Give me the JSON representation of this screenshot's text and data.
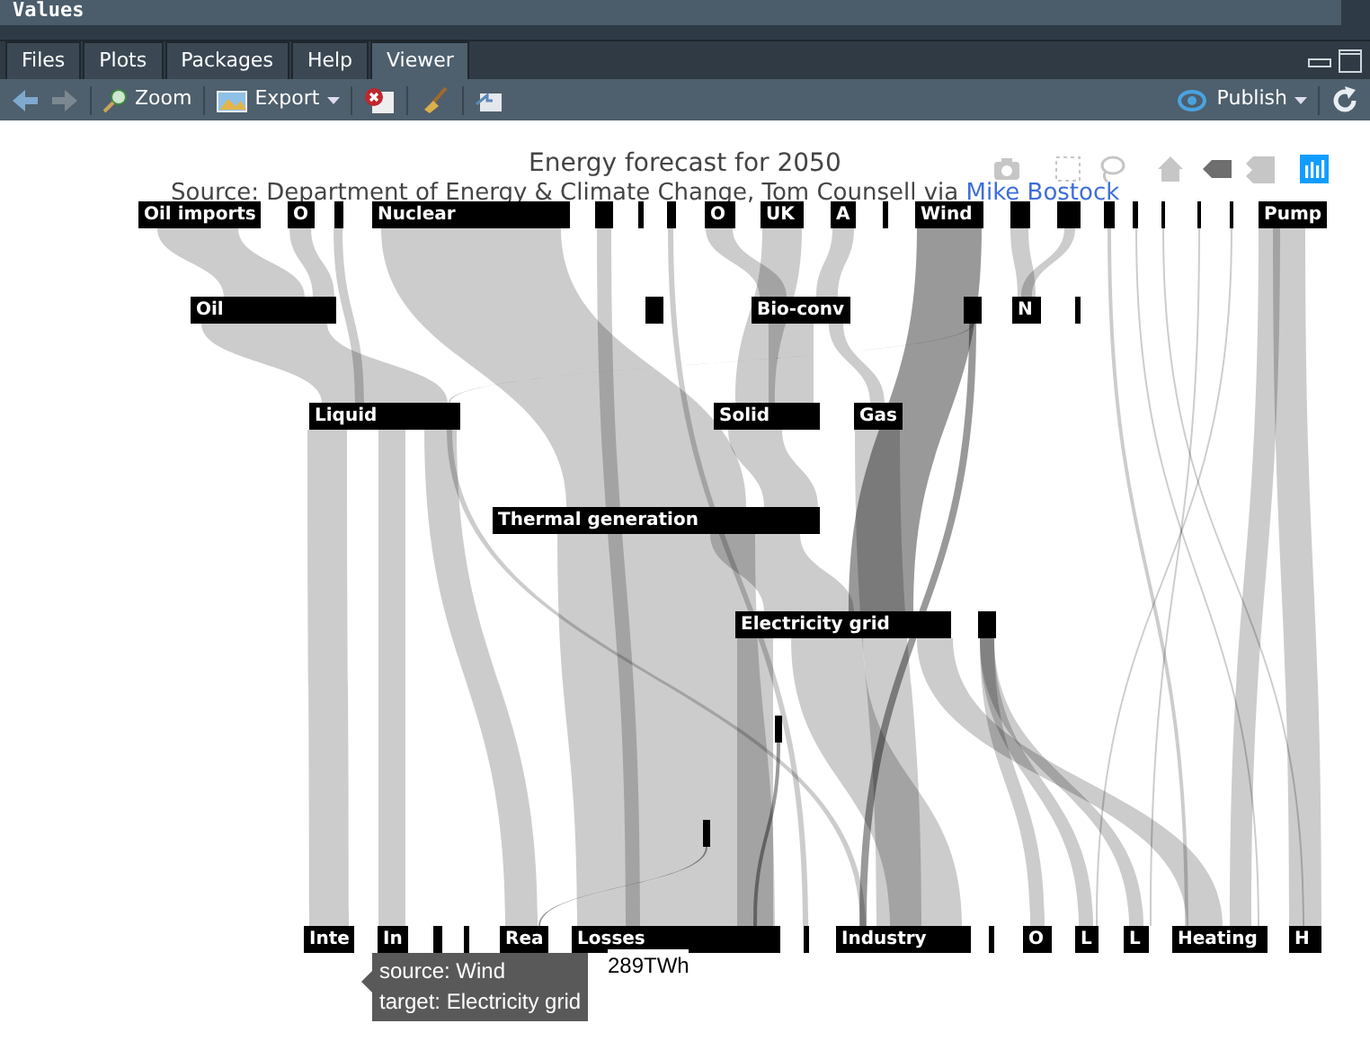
{
  "top_panel": {
    "title": "Values"
  },
  "tabs": [
    {
      "label": "Files",
      "selected": false
    },
    {
      "label": "Plots",
      "selected": false
    },
    {
      "label": "Packages",
      "selected": false
    },
    {
      "label": "Help",
      "selected": false
    },
    {
      "label": "Viewer",
      "selected": true
    }
  ],
  "toolbar": {
    "zoom": "Zoom",
    "export": "Export",
    "publish": "Publish"
  },
  "plot": {
    "title": "Energy forecast for 2050",
    "subtitle": "Source: Department of Energy & Climate Change, Tom Counsell via ",
    "subtitle_link": "Mike Bostock",
    "modebar": [
      {
        "kind": "camera",
        "selected": false
      },
      {
        "kind": "box",
        "selected": false
      },
      {
        "kind": "lasso",
        "selected": false
      },
      {
        "kind": "home",
        "selected": false
      },
      {
        "kind": "closest",
        "selected": true
      },
      {
        "kind": "compare",
        "selected": false
      },
      {
        "kind": "logo",
        "selected": false
      }
    ],
    "nodes": [
      {
        "label": "Oil imports"
      },
      {
        "label": "O"
      },
      {
        "label": "Nuclear"
      },
      {
        "label": "O"
      },
      {
        "label": "UK"
      },
      {
        "label": "A"
      },
      {
        "label": "Wind"
      },
      {
        "label": "Pump"
      },
      {
        "label": "Oil"
      },
      {
        "label": "Bio-conv"
      },
      {
        "label": "N"
      },
      {
        "label": "Liquid"
      },
      {
        "label": "Solid"
      },
      {
        "label": "Gas"
      },
      {
        "label": "Thermal generation"
      },
      {
        "label": "Electricity grid"
      },
      {
        "label": "Inte"
      },
      {
        "label": "In"
      },
      {
        "label": "Rea"
      },
      {
        "label": "Losses"
      },
      {
        "label": "Industry"
      },
      {
        "label": "O"
      },
      {
        "label": "L"
      },
      {
        "label": "L"
      },
      {
        "label": "Heating"
      },
      {
        "label": "H"
      }
    ],
    "tooltip": {
      "source": "source: Wind",
      "target": "target: Electricity grid",
      "value": "289TWh"
    }
  }
}
